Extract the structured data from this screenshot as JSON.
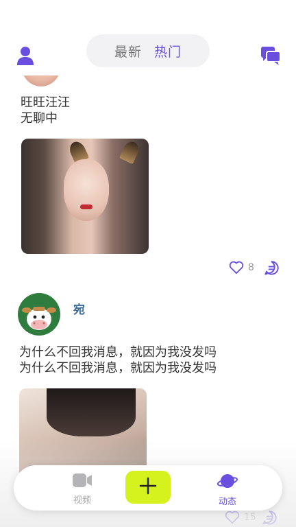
{
  "header": {
    "tabs": [
      {
        "label": "最新",
        "active": false
      },
      {
        "label": "热门",
        "active": true
      }
    ]
  },
  "posts": [
    {
      "username": "",
      "text": "旺旺汪汪\n无聊中",
      "likes": "8"
    },
    {
      "username": "宛",
      "text": "为什么不回我消息，就因为我没发吗\n为什么不回我消息，就因为我没发吗",
      "likes": "15"
    }
  ],
  "bottom_nav": {
    "video_label": "视频",
    "add_label": "+",
    "dynamic_label": "动态"
  },
  "colors": {
    "accent": "#6a4ee0",
    "add_button": "#d6f21e",
    "inactive": "#aaaaaa"
  },
  "icons": [
    "user-icon",
    "chat-icon",
    "heart-icon",
    "comment-icon",
    "video-icon",
    "plus-icon",
    "planet-icon"
  ]
}
